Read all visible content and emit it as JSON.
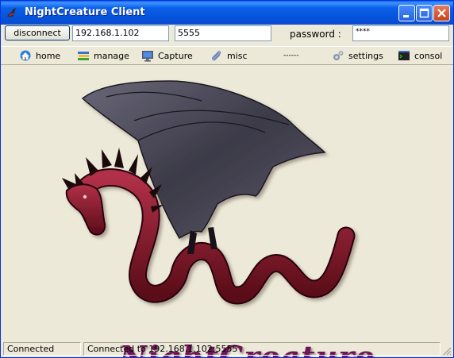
{
  "window": {
    "title": "NightCreature Client",
    "app_icon": "dragon-icon"
  },
  "connection": {
    "disconnect_label": "disconnect",
    "host": "192.168.1.102",
    "port": "5555",
    "password_label": "password :",
    "password_value": "****"
  },
  "menu": [
    {
      "label": "home",
      "icon": "home-icon"
    },
    {
      "label": "manage",
      "icon": "books-icon"
    },
    {
      "label": "Capture",
      "icon": "monitor-icon"
    },
    {
      "label": "misc",
      "icon": "paperclip-icon"
    },
    {
      "label": "------"
    },
    {
      "label": "settings",
      "icon": "gears-icon"
    },
    {
      "label": "consol",
      "icon": "terminal-icon"
    }
  ],
  "logo": {
    "text": "NightCreature"
  },
  "statusbar": {
    "state": "Connected",
    "message": "Connected to 192.168.1.102:5555"
  },
  "colors": {
    "titlebar": "#0a5fe8",
    "window_bg": "#ece9d8",
    "dragon_body": "#8b1a2a",
    "wing": "#3a3845",
    "logo_text": "#6e1557"
  }
}
